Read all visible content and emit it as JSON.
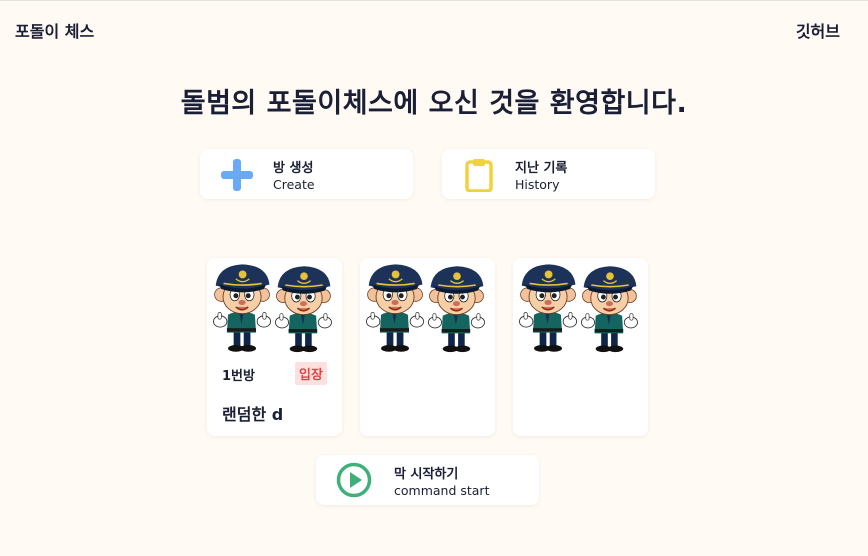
{
  "header": {
    "brand": "포돌이 체스",
    "github": "깃허브"
  },
  "headline": "돌범의 포돌이체스에 오신 것을 환영합니다.",
  "actions": {
    "create": {
      "title": "방 생성",
      "subtitle": "Create",
      "icon": "plus-icon",
      "color": "#6aa9f5"
    },
    "history": {
      "title": "지난 기록",
      "subtitle": "History",
      "icon": "clipboard-icon",
      "color": "#f0d33c"
    },
    "start": {
      "title": "막 시작하기",
      "subtitle": "command start",
      "icon": "play-circle-icon",
      "color": "#3fb07a"
    }
  },
  "rooms": [
    {
      "label": "1번방",
      "badge": "입장",
      "name": "랜덤한 d"
    },
    {
      "label": "",
      "badge": "",
      "name": ""
    },
    {
      "label": "",
      "badge": "",
      "name": ""
    }
  ]
}
